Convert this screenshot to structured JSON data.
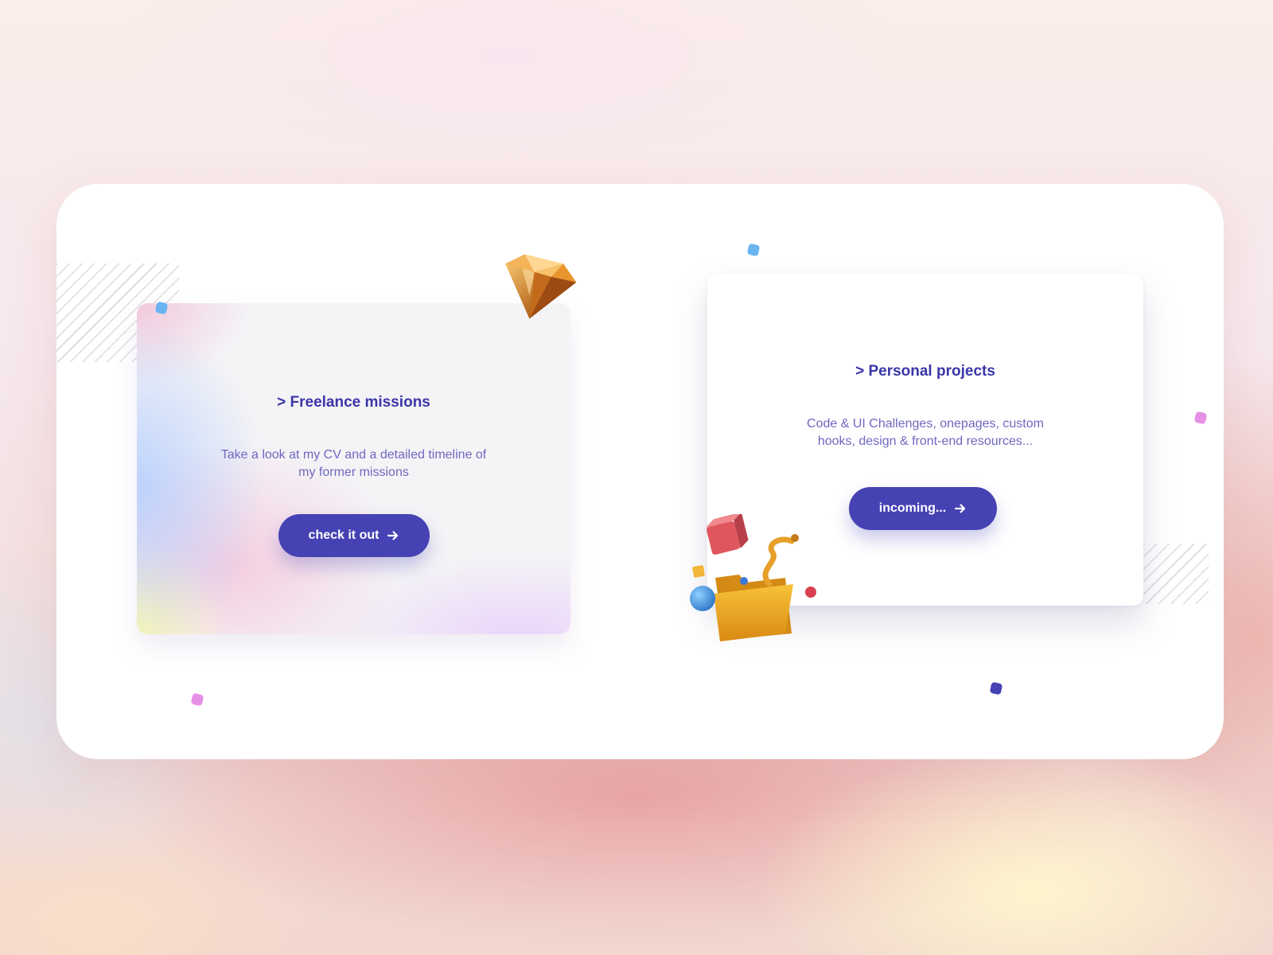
{
  "colors": {
    "accent": "#4542b4",
    "title_text": "#3a36a8",
    "body_text": "#6e68c0",
    "dot_blue": "#6bb4f2",
    "dot_pink": "#e690e6"
  },
  "cards": [
    {
      "title": "> Freelance missions",
      "description": "Take a look at my CV and a detailed timeline of my former missions",
      "button_label": "check it out",
      "button_icon": "arrow-right-icon",
      "decoration_icon": "diamond-icon"
    },
    {
      "title": "> Personal projects",
      "description": "Code & UI Challenges, onepages, custom hooks, design & front-end resources...",
      "button_label": "incoming...",
      "button_icon": "arrow-right-icon",
      "decoration_icon": "folder-icon"
    }
  ]
}
